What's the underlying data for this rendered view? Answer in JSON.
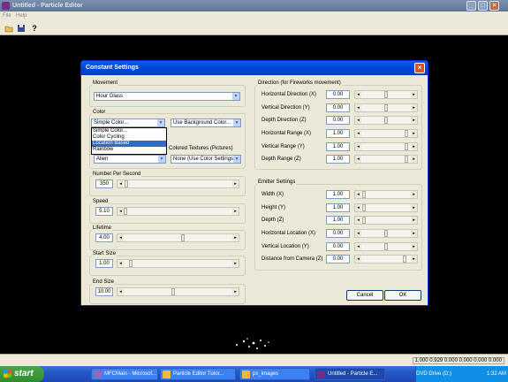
{
  "window": {
    "title": "Untitled - Particle Editor"
  },
  "menu": [
    "File",
    "Help"
  ],
  "toolbar": {
    "icons": [
      "open-icon",
      "save-icon",
      "help-icon"
    ]
  },
  "status": {
    "text": "1.000 0.929 0.000 0.000 0.000 0.000"
  },
  "taskbar": {
    "start_label": "start",
    "tasks": [
      "MFCMain - Microsof...",
      "Particle Editor Tutor...",
      "ps_images",
      "Untitled - Particle E..."
    ],
    "tray_item": "DVD Drive (D:)",
    "clock": "1:32 AM"
  },
  "dialog": {
    "title": "Constant Settings",
    "movement": {
      "label": "Movement",
      "value": "Hour Glass"
    },
    "color": {
      "label": "Color",
      "value": "Simple Color...",
      "options": [
        "Simple Color...",
        "Color Cycling",
        "Location Based",
        "Rainbow"
      ],
      "selected_option": "Location Based",
      "background": "Use Background Color...",
      "hidden_value": "Alien"
    },
    "textures": {
      "label": "Colored Textures (Pictures)",
      "value": "None (Use Color Settings)"
    },
    "left_sliders": [
      {
        "label": "Number Per Second",
        "value": "350",
        "level": 0.01
      },
      {
        "label": "Speed",
        "value": "5.10",
        "level": 0.0
      },
      {
        "label": "Lifetime",
        "value": "4.00",
        "level": 0.55
      },
      {
        "label": "Start Size",
        "value": "1.00",
        "level": 0.05
      },
      {
        "label": "End Size",
        "value": "10.00",
        "level": 0.45
      }
    ],
    "direction": {
      "label": "Direction (for Fireworks movement)",
      "rows": [
        {
          "label": "Horizontal Direction (X)",
          "value": "0.00",
          "level": 0.5
        },
        {
          "label": "Vertical Direction (Y)",
          "value": "0.00",
          "level": 0.5
        },
        {
          "label": "Depth Direction (Z)",
          "value": "0.00",
          "level": 0.5
        },
        {
          "label": "Horizontal Range (X)",
          "value": "1.00",
          "level": 0.95
        },
        {
          "label": "Vertical Range (Y)",
          "value": "1.00",
          "level": 0.95
        },
        {
          "label": "Depth Range (Z)",
          "value": "1.00",
          "level": 0.95
        }
      ]
    },
    "emitter": {
      "label": "Emitter Settings",
      "rows": [
        {
          "label": "Width (X)",
          "value": "1.00",
          "level": 0.02
        },
        {
          "label": "Height (Y)",
          "value": "1.00",
          "level": 0.02
        },
        {
          "label": "Depth (Z)",
          "value": "1.00",
          "level": 0.02
        },
        {
          "label": "Horizontal Location (X)",
          "value": "0.00",
          "level": 0.5
        },
        {
          "label": "Vertical Location (Y)",
          "value": "0.00",
          "level": 0.5
        },
        {
          "label": "Distance from Camera (Z)",
          "value": "0.00",
          "level": 0.9
        }
      ]
    },
    "cancel_label": "Cancel",
    "ok_label": "OK"
  }
}
